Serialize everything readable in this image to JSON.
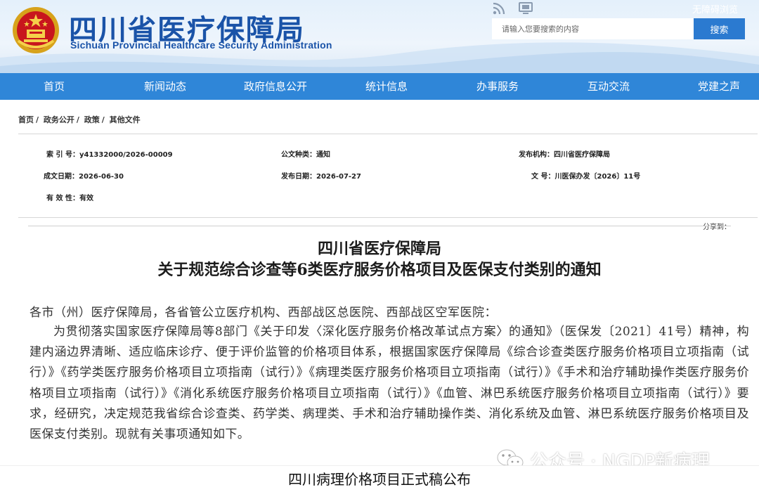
{
  "header": {
    "site_title_cn": "四川省医疗保障局",
    "site_title_en": "Sichuan Provincial Healthcare Security Administration",
    "emblem_icon": "national-emblem-icon",
    "rss_icon": "rss-icon",
    "monitor_icon": "monitor-icon",
    "accessible_link": "无障碍浏览",
    "search": {
      "placeholder": "请输入您要搜索的内容",
      "button_label": "搜索"
    }
  },
  "nav": {
    "items": [
      {
        "label": "首页"
      },
      {
        "label": "新闻动态"
      },
      {
        "label": "政府信息公开"
      },
      {
        "label": "统计信息"
      },
      {
        "label": "办事服务"
      },
      {
        "label": "互动交流"
      },
      {
        "label": "党建之声"
      }
    ]
  },
  "breadcrumb": [
    "首页",
    "政务公开",
    "政策",
    "其他文件"
  ],
  "breadcrumb_separator": "/",
  "meta": {
    "index_no": {
      "label": "索 引 号：",
      "value": "y41332000/2026-00009"
    },
    "doc_type": {
      "label": "公文种类：",
      "value": "通知"
    },
    "publisher": {
      "label": "发布机构：",
      "value": "四川省医疗保障局"
    },
    "created_date": {
      "label": "成文日期：",
      "value": "2026-06-30"
    },
    "publish_date": {
      "label": "发布日期：",
      "value": "2026-07-27"
    },
    "doc_number": {
      "label": "文 号：",
      "value": "川医保办发〔2026〕11号"
    },
    "validity": {
      "label": "有 效 性：",
      "value": "有效"
    }
  },
  "share_label": "分享到：",
  "article": {
    "title_line1": "四川省医疗保障局",
    "title_line2": "关于规范综合诊查等6类医疗服务价格项目及医保支付类别的通知",
    "salutation": "各市（州）医疗保障局，各省管公立医疗机构、西部战区总医院、西部战区空军医院：",
    "paragraph": "为贯彻落实国家医疗保障局等8部门《关于印发〈深化医疗服务价格改革试点方案〉的通知》（医保发〔2021〕41号）精神，构建内涵边界清晰、适应临床诊疗、便于评价监管的价格项目体系，根据国家医疗保障局《综合诊查类医疗服务价格项目立项指南（试行）》《药学类医疗服务价格项目立项指南（试行）》《病理类医疗服务价格项目立项指南（试行）》《手术和治疗辅助操作类医疗服务价格项目立项指南（试行）》《消化系统医疗服务价格项目立项指南（试行）》《血管、淋巴系统医疗服务价格项目立项指南（试行）》要求，经研究，决定规范我省综合诊查类、药学类、病理类、手术和治疗辅助操作类、消化系统及血管、淋巴系统医疗服务价格项目及医保支付类别。现就有关事项通知如下。"
  },
  "watermark": {
    "icon": "wechat-icon",
    "text": "公众号 · NGDP新病理"
  },
  "caption": "四川病理价格项目正式稿公布",
  "colors": {
    "nav_bg": "#2f86d8",
    "title_blue": "#1a53a8",
    "search_button": "#2b7ad0"
  }
}
